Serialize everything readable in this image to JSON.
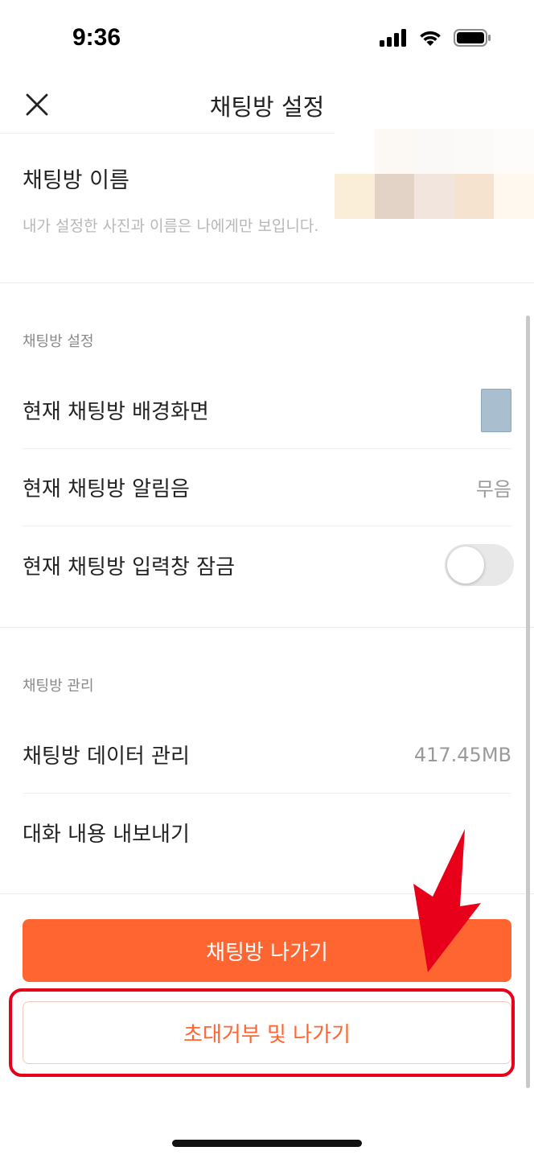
{
  "status_bar": {
    "time": "9:36"
  },
  "header": {
    "title": "채팅방 설정",
    "close_icon": "close-icon"
  },
  "name_section": {
    "label": "채팅방 이름",
    "note": "내가 설정한 사진과 이름은 나에게만 보입니다.",
    "thumbnail_colors": [
      "#ffffff",
      "#fcf8f3",
      "#fbf9f8",
      "#fcfaf9",
      "#fefcfa",
      "#fbeed8",
      "#e2d3c6",
      "#f1e5dd",
      "#f6e3cf",
      "#fef8ee"
    ]
  },
  "settings_section": {
    "label": "채팅방 설정",
    "rows": [
      {
        "label": "현재 채팅방 배경화면",
        "swatch_color": "#a9bfcf"
      },
      {
        "label": "현재 채팅방 알림음",
        "value": "무음"
      },
      {
        "label": "현재 채팅방 입력창 잠금",
        "toggle_on": false
      }
    ]
  },
  "manage_section": {
    "label": "채팅방 관리",
    "rows": [
      {
        "label": "채팅방 데이터 관리",
        "value": "417.45MB"
      },
      {
        "label": "대화 내용 내보내기"
      }
    ]
  },
  "actions": {
    "leave_label": "채팅방 나가기",
    "decline_leave_label": "초대거부 및 나가기"
  },
  "colors": {
    "accent": "#ff6531",
    "annotation": "#e8001a"
  }
}
